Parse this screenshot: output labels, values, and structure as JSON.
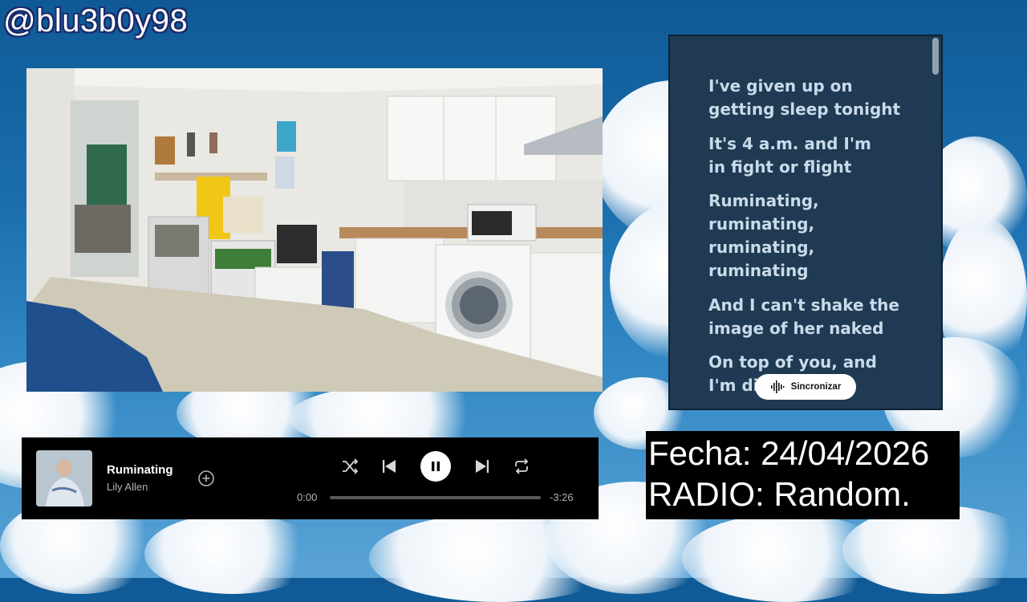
{
  "overlay": {
    "handle": "@blu3b0y98"
  },
  "lyrics_panel": {
    "lines": [
      "I've given up on",
      "getting sleep tonight",
      "It's 4 a.m. and I'm",
      "in fight or flight",
      "Ruminating,",
      "ruminating,",
      "ruminating,",
      "ruminating",
      "And I can't shake the",
      "image of her naked",
      "On top of you, and",
      "I'm di"
    ],
    "sync_button_label": "Sincronizar",
    "sync_icon": "soundwave-icon"
  },
  "player": {
    "track_title": "Ruminating",
    "artist": "Lily Allen",
    "elapsed": "0:00",
    "remaining": "-3:26",
    "progress": 0.0,
    "is_playing": true,
    "icons": {
      "add": "add-circle-icon",
      "shuffle": "shuffle-icon",
      "previous": "previous-icon",
      "pause": "pause-icon",
      "next": "next-icon",
      "repeat": "repeat-icon"
    }
  },
  "info_box": {
    "date_line": "Fecha: 24/04/2026",
    "radio_line": "RADIO: Random."
  },
  "colors": {
    "lyrics_bg": "#1f3a52",
    "lyrics_text": "#c9daea",
    "player_bg": "#000000",
    "accent_white": "#ffffff"
  }
}
